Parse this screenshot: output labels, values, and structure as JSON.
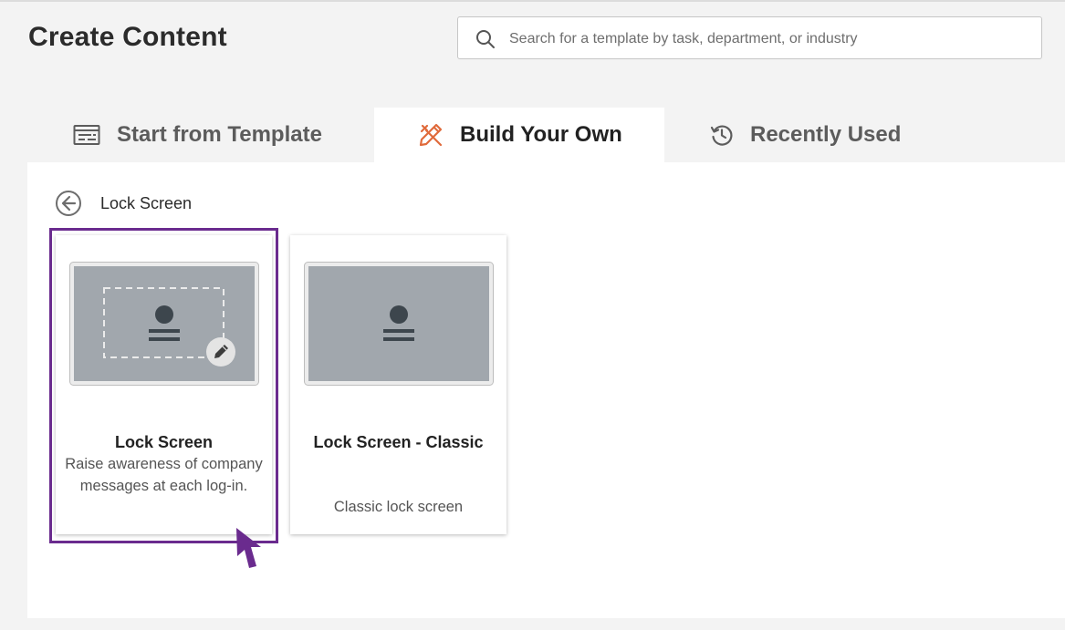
{
  "header": {
    "title": "Create Content",
    "search_placeholder": "Search for a template by task, department, or industry"
  },
  "tabs": [
    {
      "label": "Start from Template",
      "icon": "template-icon",
      "active": false
    },
    {
      "label": "Build Your Own",
      "icon": "build-tools-icon",
      "active": true
    },
    {
      "label": "Recently Used",
      "icon": "history-icon",
      "active": false
    }
  ],
  "breadcrumb": {
    "label": "Lock Screen",
    "back_icon": "back-arrow-icon"
  },
  "cards": [
    {
      "title": "Lock Screen",
      "description": "Raise awareness of company messages at each log-in.",
      "selected": true,
      "icon": "edit-pencil-icon"
    },
    {
      "title": "Lock Screen - Classic",
      "description": "Classic lock screen",
      "selected": false
    }
  ],
  "colors": {
    "selection_border": "#6a2b8e",
    "active_tab_icon": "#e06a3b",
    "thumbnail_fill": "#a1a7ad",
    "thumbnail_figure": "#3d464d"
  }
}
